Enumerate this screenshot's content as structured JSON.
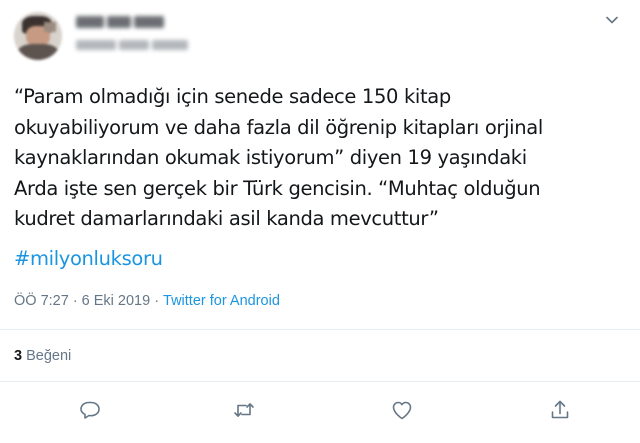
{
  "tweet": {
    "text": "“Param olmadığı için senede sadece 150 kitap\nokuyabiliyorum ve daha fazla dil öğrenip kitapları orjinal\nkaynaklarından okumak istiyorum” diyen 19 yaşındaki\nArda işte sen gerçek bir Türk gencisin. “Muhtaç olduğun\nkudret damarlarındaki asil kanda mevcuttur”",
    "hashtag": "#milyonluksoru",
    "time": "ÖÖ 7:27",
    "separator": "·",
    "date": "6 Eki 2019",
    "separator2": "·",
    "source": "Twitter for Android"
  },
  "stats": {
    "likes_count": "3",
    "likes_label": "Beğeni"
  },
  "icons": {
    "caret": "chevron-down-icon",
    "reply": "reply-icon",
    "retweet": "retweet-icon",
    "like": "heart-icon",
    "share": "share-icon"
  },
  "colors": {
    "link": "#1b95e0",
    "text": "#14171a",
    "muted": "#657786",
    "divider": "#e6ecf0"
  }
}
